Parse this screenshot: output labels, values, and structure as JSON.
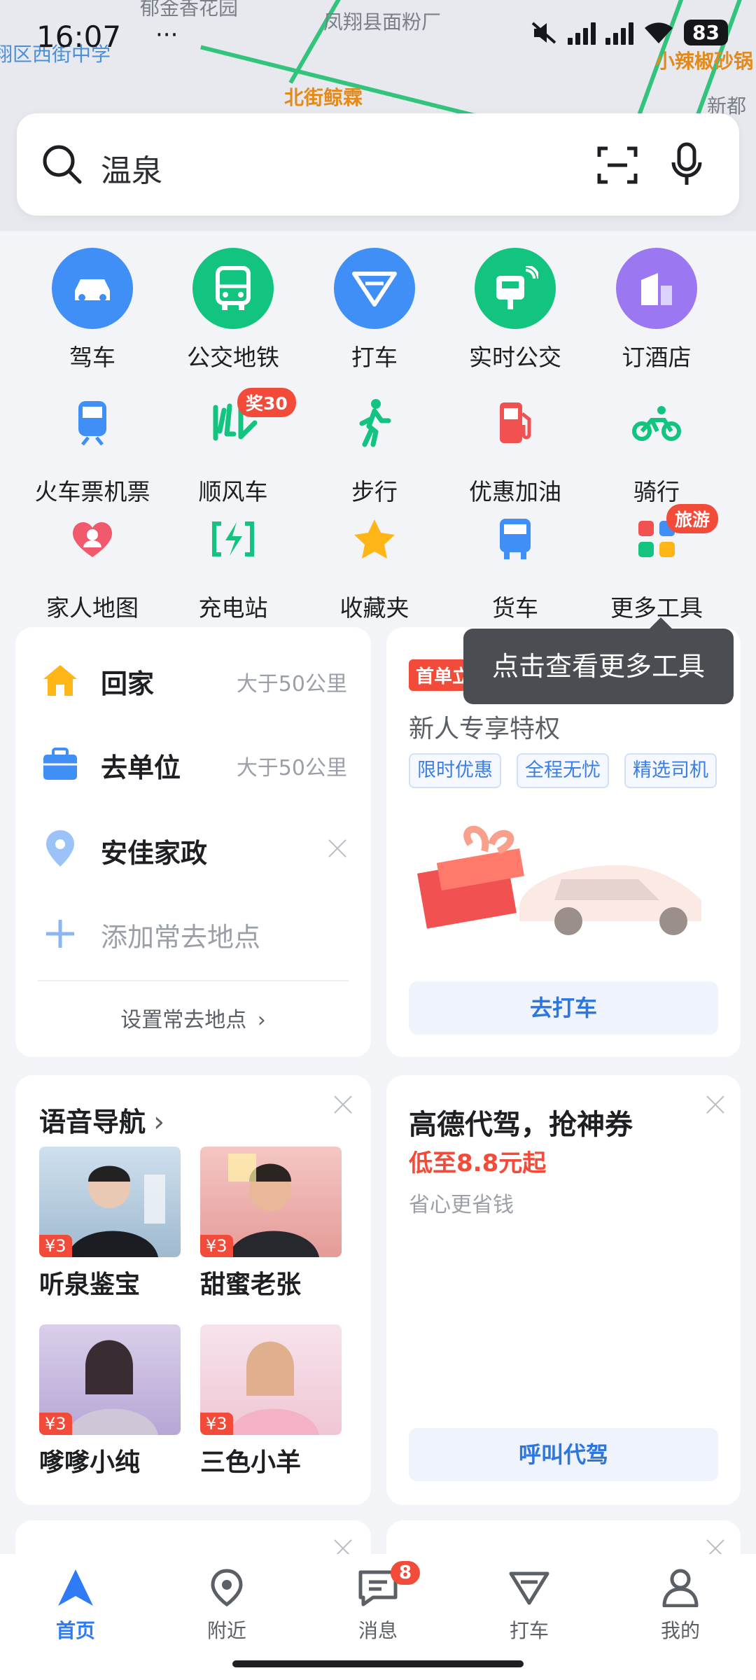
{
  "status_bar": {
    "time": "16:07",
    "dots": "···",
    "battery": "83"
  },
  "map_labels": [
    "郁金香花园",
    "凤翔县面粉厂",
    "翔区西街中学",
    "北街鲸霖",
    "小辣椒砂锅",
    "新都"
  ],
  "search": {
    "placeholder": "温泉"
  },
  "tools": [
    {
      "label": "驾车",
      "icon": "car-icon"
    },
    {
      "label": "公交地铁",
      "icon": "bus-icon"
    },
    {
      "label": "打车",
      "icon": "taxi-icon"
    },
    {
      "label": "实时公交",
      "icon": "realtime-bus-icon"
    },
    {
      "label": "订酒店",
      "icon": "hotel-icon"
    },
    {
      "label": "火车票机票",
      "icon": "train-icon"
    },
    {
      "label": "顺风车",
      "icon": "carpool-icon",
      "badge": "奖30"
    },
    {
      "label": "步行",
      "icon": "walk-icon"
    },
    {
      "label": "优惠加油",
      "icon": "gas-icon"
    },
    {
      "label": "骑行",
      "icon": "bike-icon"
    },
    {
      "label": "家人地图",
      "icon": "family-map-icon"
    },
    {
      "label": "充电站",
      "icon": "charging-icon"
    },
    {
      "label": "收藏夹",
      "icon": "star-icon"
    },
    {
      "label": "货车",
      "icon": "truck-icon"
    },
    {
      "label": "更多工具",
      "icon": "more-tools-icon",
      "badge": "旅游"
    }
  ],
  "tooltip": "点击查看更多工具",
  "places": {
    "home": {
      "label": "回家",
      "dist": "大于50公里"
    },
    "work": {
      "label": "去单位",
      "dist": "大于50公里"
    },
    "saved": {
      "label": "安佳家政"
    },
    "add": {
      "label": "添加常去地点"
    },
    "setting_link": "设置常去地点"
  },
  "taxi_card": {
    "tag": "首单立",
    "title": "新人专享特权",
    "tags": [
      "限时优惠",
      "全程无忧",
      "精选司机"
    ],
    "button": "去打车"
  },
  "voice_card": {
    "title": "语音导航",
    "items": [
      {
        "name": "听泉鉴宝",
        "price": "¥3"
      },
      {
        "name": "甜蜜老张",
        "price": "¥3"
      },
      {
        "name": "嗲嗲小纯",
        "price": "¥3"
      },
      {
        "name": "三色小羊",
        "price": "¥3"
      }
    ]
  },
  "driver_card": {
    "title": "高德代驾，抢神券",
    "promo": "低至8.8元起",
    "subtitle": "省心更省钱",
    "button": "呼叫代驾"
  },
  "tabs": [
    {
      "label": "首页",
      "active": true
    },
    {
      "label": "附近"
    },
    {
      "label": "消息",
      "badge": "8"
    },
    {
      "label": "打车"
    },
    {
      "label": "我的"
    }
  ],
  "colors": {
    "accent": "#2f7bf5",
    "green": "#12c47f",
    "red": "#f24b3a"
  }
}
